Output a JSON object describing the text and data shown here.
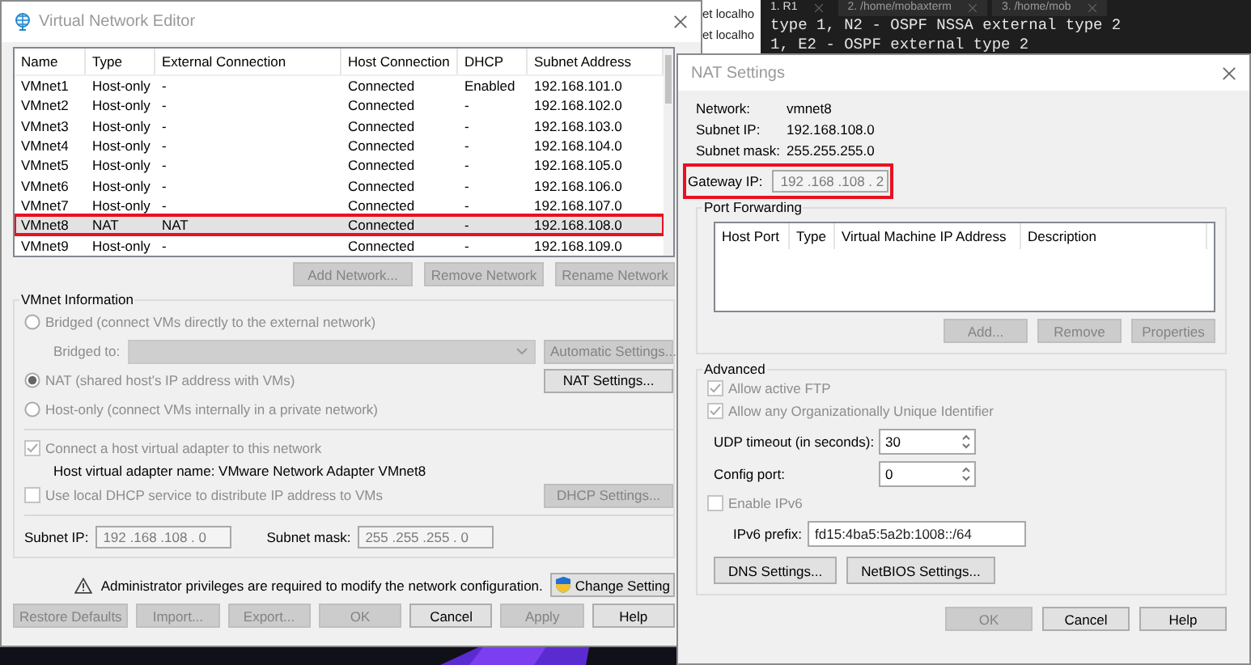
{
  "terminal": {
    "tabs": [
      {
        "label": "1. R1",
        "selected": true
      },
      {
        "label": "2. /home/mobaxterm",
        "selected": false
      },
      {
        "label": "3. /home/mob",
        "selected": false
      }
    ],
    "lines": [
      "type 1, N2 - OSPF NSSA external type 2",
      "1, E2 - OSPF external type 2"
    ]
  },
  "background_window": {
    "lines": [
      "et localho",
      "et localho"
    ]
  },
  "network_editor": {
    "title": "Virtual Network Editor",
    "table": {
      "columns": [
        "Name",
        "Type",
        "External Connection",
        "Host Connection",
        "DHCP",
        "Subnet Address"
      ],
      "rows": [
        {
          "cells": [
            "VMnet1",
            "Host-only",
            "-",
            "Connected",
            "Enabled",
            "192.168.101.0"
          ],
          "selected": false,
          "highlighted": false
        },
        {
          "cells": [
            "VMnet2",
            "Host-only",
            "-",
            "Connected",
            "-",
            "192.168.102.0"
          ],
          "selected": false,
          "highlighted": false
        },
        {
          "cells": [
            "VMnet3",
            "Host-only",
            "-",
            "Connected",
            "-",
            "192.168.103.0"
          ],
          "selected": false,
          "highlighted": false
        },
        {
          "cells": [
            "VMnet4",
            "Host-only",
            "-",
            "Connected",
            "-",
            "192.168.104.0"
          ],
          "selected": false,
          "highlighted": false
        },
        {
          "cells": [
            "VMnet5",
            "Host-only",
            "-",
            "Connected",
            "-",
            "192.168.105.0"
          ],
          "selected": false,
          "highlighted": false
        },
        {
          "cells": [
            "VMnet6",
            "Host-only",
            "-",
            "Connected",
            "-",
            "192.168.106.0"
          ],
          "selected": false,
          "highlighted": false
        },
        {
          "cells": [
            "VMnet7",
            "Host-only",
            "-",
            "Connected",
            "-",
            "192.168.107.0"
          ],
          "selected": false,
          "highlighted": false
        },
        {
          "cells": [
            "VMnet8",
            "NAT",
            "NAT",
            "Connected",
            "-",
            "192.168.108.0"
          ],
          "selected": true,
          "highlighted": true
        },
        {
          "cells": [
            "VMnet9",
            "Host-only",
            "-",
            "Connected",
            "-",
            "192.168.109.0"
          ],
          "selected": false,
          "highlighted": false
        }
      ]
    },
    "table_buttons": [
      {
        "label": "Add Network...",
        "disabled": true
      },
      {
        "label": "Remove Network",
        "disabled": true
      },
      {
        "label": "Rename Network",
        "disabled": true
      }
    ],
    "vmnet_information": {
      "title": "VMnet Information",
      "radios": [
        {
          "label": "Bridged (connect VMs directly to the external network)",
          "selected": false,
          "disabled": true
        },
        {
          "label": "NAT (shared host's IP address with VMs)",
          "selected": true,
          "disabled": true,
          "button": {
            "label": "NAT Settings...",
            "disabled": false
          }
        },
        {
          "label": "Host-only (connect VMs internally in a private network)",
          "selected": false,
          "disabled": true
        }
      ],
      "bridged_to": {
        "label": "Bridged to:",
        "disabled": true,
        "button": {
          "label": "Automatic Settings...",
          "disabled": true
        }
      },
      "checkboxes": [
        {
          "label": "Connect a host virtual adapter to this network",
          "checked": true,
          "disabled": true
        },
        {
          "label": "Use local DHCP service to distribute IP address to VMs",
          "checked": false,
          "disabled": true,
          "button": {
            "label": "DHCP Settings...",
            "disabled": true
          }
        }
      ],
      "adapter_name": "Host virtual adapter name: VMware Network Adapter VMnet8",
      "subnet_ip": {
        "label": "Subnet IP:",
        "value": "192 .168 .108 . 0"
      },
      "subnet_mask": {
        "label": "Subnet mask:",
        "value": "255 .255 .255 . 0"
      }
    },
    "notice": {
      "text": "Administrator privileges are required to modify the network configuration.",
      "button": "Change Setting"
    },
    "buttons": [
      {
        "label": "Restore Defaults",
        "disabled": true
      },
      {
        "label": "Import...",
        "disabled": true
      },
      {
        "label": "Export...",
        "disabled": true
      },
      {
        "label": "OK",
        "disabled": true
      },
      {
        "label": "Cancel",
        "disabled": false
      },
      {
        "label": "Apply",
        "disabled": true
      },
      {
        "label": "Help",
        "disabled": false
      }
    ]
  },
  "nat_settings": {
    "title": "NAT Settings",
    "info": [
      {
        "label": "Network:",
        "value": "vmnet8"
      },
      {
        "label": "Subnet IP:",
        "value": "192.168.108.0"
      },
      {
        "label": "Subnet mask:",
        "value": "255.255.255.0"
      }
    ],
    "gateway": {
      "label": "Gateway IP:",
      "value": "192 .168 .108 . 2",
      "highlighted": true
    },
    "port_forwarding": {
      "title": "Port Forwarding",
      "columns": [
        "Host Port",
        "Type",
        "Virtual Machine IP Address",
        "Description"
      ],
      "buttons": [
        {
          "label": "Add...",
          "disabled": true
        },
        {
          "label": "Remove",
          "disabled": true
        },
        {
          "label": "Properties",
          "disabled": true
        }
      ]
    },
    "advanced": {
      "title": "Advanced",
      "checkboxes": [
        {
          "label": "Allow active FTP",
          "checked": true,
          "disabled": true
        },
        {
          "label": "Allow any Organizationally Unique Identifier",
          "checked": true,
          "disabled": true
        }
      ],
      "spinners": [
        {
          "label": "UDP timeout (in seconds):",
          "value": "30"
        },
        {
          "label": "Config port:",
          "value": "0"
        }
      ],
      "ipv6": {
        "label": "Enable IPv6",
        "checked": false,
        "disabled": true
      },
      "ipv6_prefix": {
        "label": "IPv6 prefix:",
        "value": "fd15:4ba5:5a2b:1008::/64"
      },
      "buttons": [
        {
          "label": "DNS Settings...",
          "disabled": false
        },
        {
          "label": "NetBIOS Settings...",
          "disabled": false
        }
      ]
    },
    "buttons": [
      {
        "label": "OK",
        "disabled": true
      },
      {
        "label": "Cancel",
        "disabled": false
      },
      {
        "label": "Help",
        "disabled": false
      }
    ]
  }
}
